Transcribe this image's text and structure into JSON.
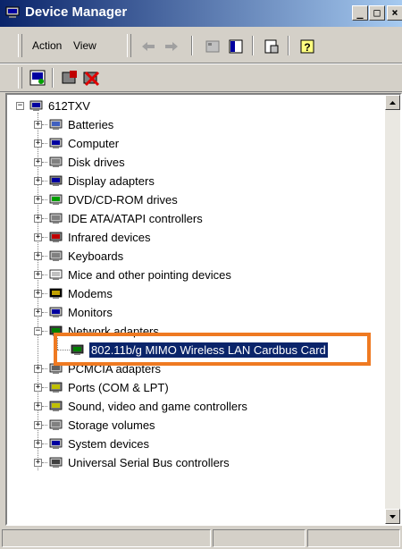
{
  "window": {
    "title": "Device Manager"
  },
  "titlebar_buttons": {
    "minimize": "_",
    "maximize": "□",
    "close": "×"
  },
  "menu": {
    "action": "Action",
    "view": "View"
  },
  "tree": {
    "root": "612TXV",
    "items": [
      {
        "label": "Batteries",
        "icon": "battery-icon"
      },
      {
        "label": "Computer",
        "icon": "computer-icon"
      },
      {
        "label": "Disk drives",
        "icon": "disk-drive-icon"
      },
      {
        "label": "Display adapters",
        "icon": "display-adapter-icon"
      },
      {
        "label": "DVD/CD-ROM drives",
        "icon": "dvd-drive-icon"
      },
      {
        "label": "IDE ATA/ATAPI controllers",
        "icon": "ide-controller-icon"
      },
      {
        "label": "Infrared devices",
        "icon": "infrared-icon"
      },
      {
        "label": "Keyboards",
        "icon": "keyboard-icon"
      },
      {
        "label": "Mice and other pointing devices",
        "icon": "mouse-icon"
      },
      {
        "label": "Modems",
        "icon": "modem-icon"
      },
      {
        "label": "Monitors",
        "icon": "monitor-icon"
      },
      {
        "label": "Network adapters",
        "icon": "network-adapter-icon"
      },
      {
        "label": "PCMCIA adapters",
        "icon": "pcmcia-icon"
      },
      {
        "label": "Ports (COM & LPT)",
        "icon": "port-icon"
      },
      {
        "label": "Sound, video and game controllers",
        "icon": "sound-icon"
      },
      {
        "label": "Storage volumes",
        "icon": "storage-icon"
      },
      {
        "label": "System devices",
        "icon": "system-devices-icon"
      },
      {
        "label": "Universal Serial Bus controllers",
        "icon": "usb-icon"
      }
    ],
    "child": "802.11b/g MIMO Wireless LAN Cardbus Card"
  },
  "colors": {
    "selection": "#0a246a",
    "highlight": "#ef7a22",
    "title_start": "#0a246a",
    "title_end": "#a6caf0"
  }
}
